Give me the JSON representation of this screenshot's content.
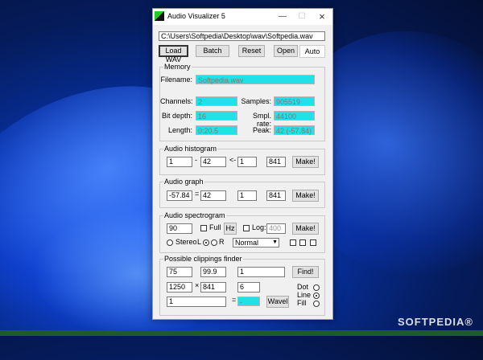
{
  "window": {
    "title": "Audio Visualizer 5",
    "path": "C:\\Users\\Softpedia\\Desktop\\wav\\Softpedia.wav"
  },
  "toolbar": {
    "load": "Load WAV",
    "batch": "Batch",
    "reset": "Reset",
    "open": "Open",
    "auto": "Auto"
  },
  "memory": {
    "title": "Memory",
    "filename_label": "Filename:",
    "filename": "Softpedia.wav",
    "channels_label": "Channels:",
    "channels": "2",
    "samples_label": "Samples:",
    "samples": "905519",
    "bitdepth_label": "Bit depth:",
    "bitdepth": "16",
    "rate_label": "Smpl. rate:",
    "rate": "44100",
    "length_label": "Length:",
    "length": "0:20.5",
    "peak_label": "Peak:",
    "peak": "42 (-57.84)"
  },
  "histogram": {
    "title": "Audio histogram",
    "v1": "1",
    "sep1": "-",
    "v2": "42",
    "sep2": "<-",
    "v3": "1",
    "v4": "841",
    "make": "Make!"
  },
  "graph": {
    "title": "Audio graph",
    "v1": "-57.84",
    "sep1": "=",
    "v2": "42",
    "v3": "1",
    "v4": "841",
    "make": "Make!"
  },
  "spectrogram": {
    "title": "Audio spectrogram",
    "v1": "90",
    "full": "Full",
    "hz": "Hz",
    "log": "Log:",
    "log_value": "400",
    "make": "Make!",
    "stereo": "Stereo",
    "l": "L",
    "r": "R",
    "mode": "Normal"
  },
  "clippings": {
    "title": "Possible clippings finder",
    "v1": "75",
    "v2": "99.9",
    "v3": "1",
    "find": "Find!",
    "v4": "1250",
    "sep1": "×",
    "v5": "841",
    "v6": "6",
    "v7": "1",
    "sep2": "=",
    "result": "-",
    "wavel": "Wavel",
    "dot": "Dot",
    "line": "Line",
    "fill": "Fill"
  },
  "watermark": "SOFTPEDIA®"
}
